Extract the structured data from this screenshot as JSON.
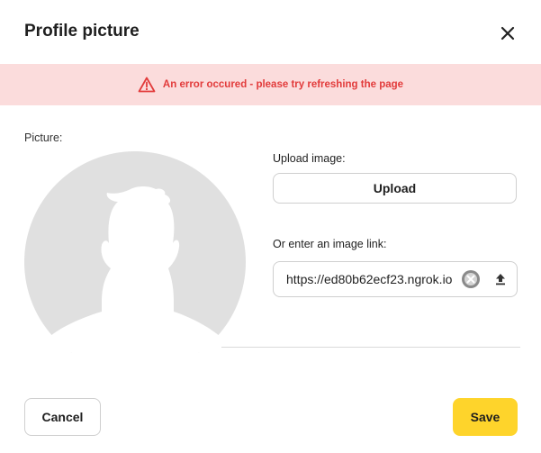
{
  "dialog": {
    "title": "Profile picture",
    "close_icon": "close-icon"
  },
  "error": {
    "message": "An error occured - please try refreshing the page",
    "icon": "warning-icon",
    "color": "#e23b3b",
    "background": "#fbdcdc"
  },
  "picture": {
    "label": "Picture:",
    "avatar_icon": "default-avatar-icon"
  },
  "upload": {
    "label": "Upload image:",
    "button_label": "Upload"
  },
  "link": {
    "label": "Or enter an image link:",
    "value": "https://ed80b62ecf23.ngrok.io",
    "clear_icon": "clear-icon",
    "submit_icon": "upload-arrow-icon"
  },
  "footer": {
    "cancel_label": "Cancel",
    "save_label": "Save",
    "save_color": "#fed42b"
  }
}
